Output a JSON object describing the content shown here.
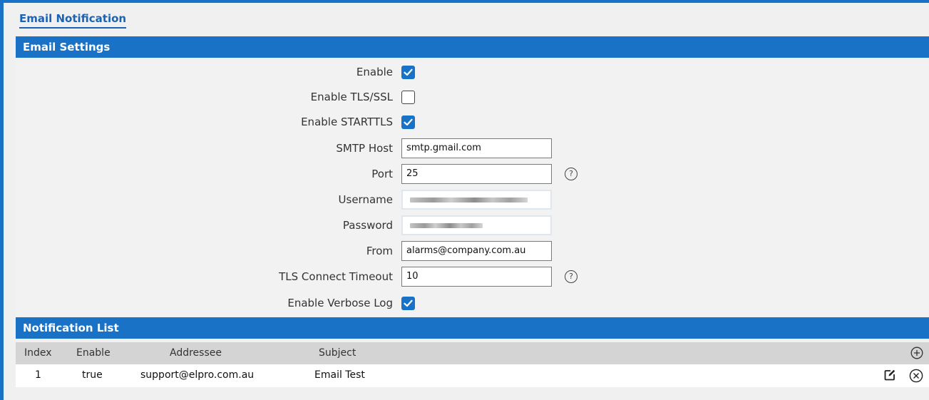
{
  "page": {
    "title": "Email Notification"
  },
  "email_settings": {
    "header": "Email Settings",
    "fields": {
      "enable": {
        "label": "Enable",
        "checked": true
      },
      "enable_tls_ssl": {
        "label": "Enable TLS/SSL",
        "checked": false
      },
      "enable_starttls": {
        "label": "Enable STARTTLS",
        "checked": true
      },
      "smtp_host": {
        "label": "SMTP Host",
        "value": "smtp.gmail.com"
      },
      "port": {
        "label": "Port",
        "value": "25",
        "help_icon": "question-circle-icon"
      },
      "username": {
        "label": "Username",
        "value_obscured": true
      },
      "password": {
        "label": "Password",
        "value_obscured": true
      },
      "from": {
        "label": "From",
        "value": "alarms@company.com.au"
      },
      "tls_connect_timeout": {
        "label": "TLS Connect Timeout",
        "value": "10",
        "help_icon": "question-circle-icon"
      },
      "enable_verbose_log": {
        "label": "Enable Verbose Log",
        "checked": true
      }
    }
  },
  "notification_list": {
    "header": "Notification List",
    "columns": {
      "index": "Index",
      "enable": "Enable",
      "addressee": "Addressee",
      "subject": "Subject"
    },
    "rows": [
      {
        "index": "1",
        "enable": "true",
        "addressee": "support@elpro.com.au",
        "subject": "Email Test"
      }
    ],
    "icons": {
      "add": "add-circle-icon",
      "edit": "edit-icon",
      "delete": "delete-circle-icon"
    }
  },
  "colors": {
    "accent": "#1a72c7",
    "title_link": "#1a63b5",
    "panel_bg": "#f2f2f2",
    "table_header_bg": "#d4d4d4"
  }
}
